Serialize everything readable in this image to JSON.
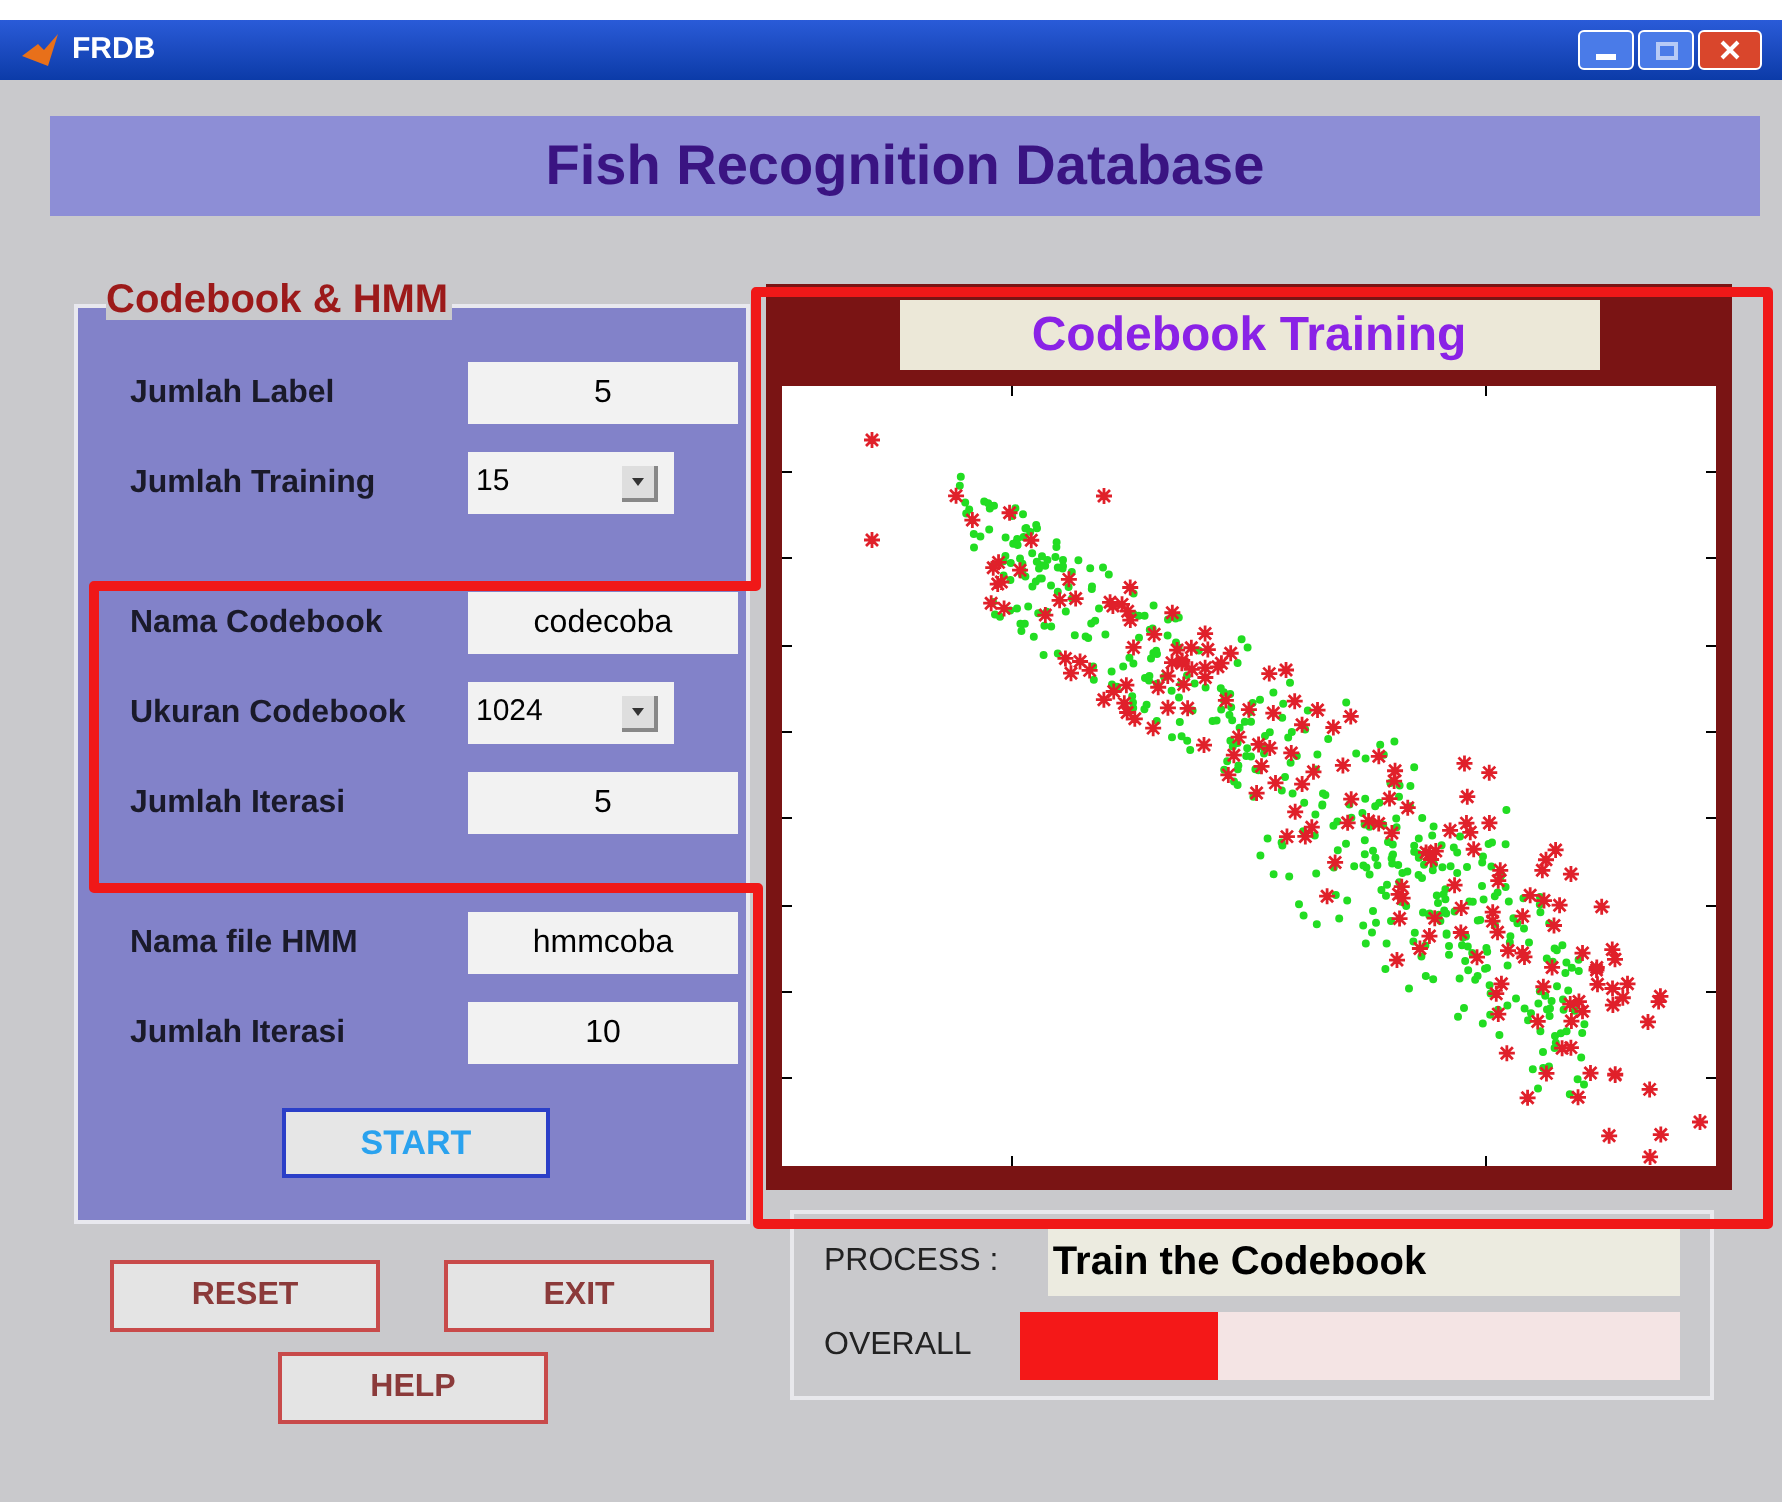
{
  "window": {
    "title": "FRDB"
  },
  "header": {
    "title": "Fish Recognition Database"
  },
  "codebook_panel": {
    "title": "Codebook & HMM",
    "sections": [
      {
        "fields": [
          {
            "label": "Jumlah Label",
            "kind": "text",
            "value": "5"
          },
          {
            "label": "Jumlah Training",
            "kind": "dropdown",
            "value": "15"
          }
        ]
      },
      {
        "fields": [
          {
            "label": "Nama Codebook",
            "kind": "text",
            "value": "codecoba"
          },
          {
            "label": "Ukuran Codebook",
            "kind": "dropdown",
            "value": "1024"
          },
          {
            "label": "Jumlah Iterasi",
            "kind": "text",
            "value": "5"
          }
        ]
      },
      {
        "fields": [
          {
            "label": "Nama file HMM",
            "kind": "text",
            "value": "hmmcoba"
          },
          {
            "label": "Jumlah Iterasi",
            "kind": "text",
            "value": "10"
          }
        ]
      }
    ],
    "start_button": "START"
  },
  "buttons": [
    "RESET",
    "EXIT",
    "HELP"
  ],
  "plot_panel": {
    "title": "Codebook Training"
  },
  "status": {
    "process_label": "PROCESS :",
    "process_value": "Train the Codebook",
    "overall_label": "OVERALL",
    "level": 0.3
  }
}
